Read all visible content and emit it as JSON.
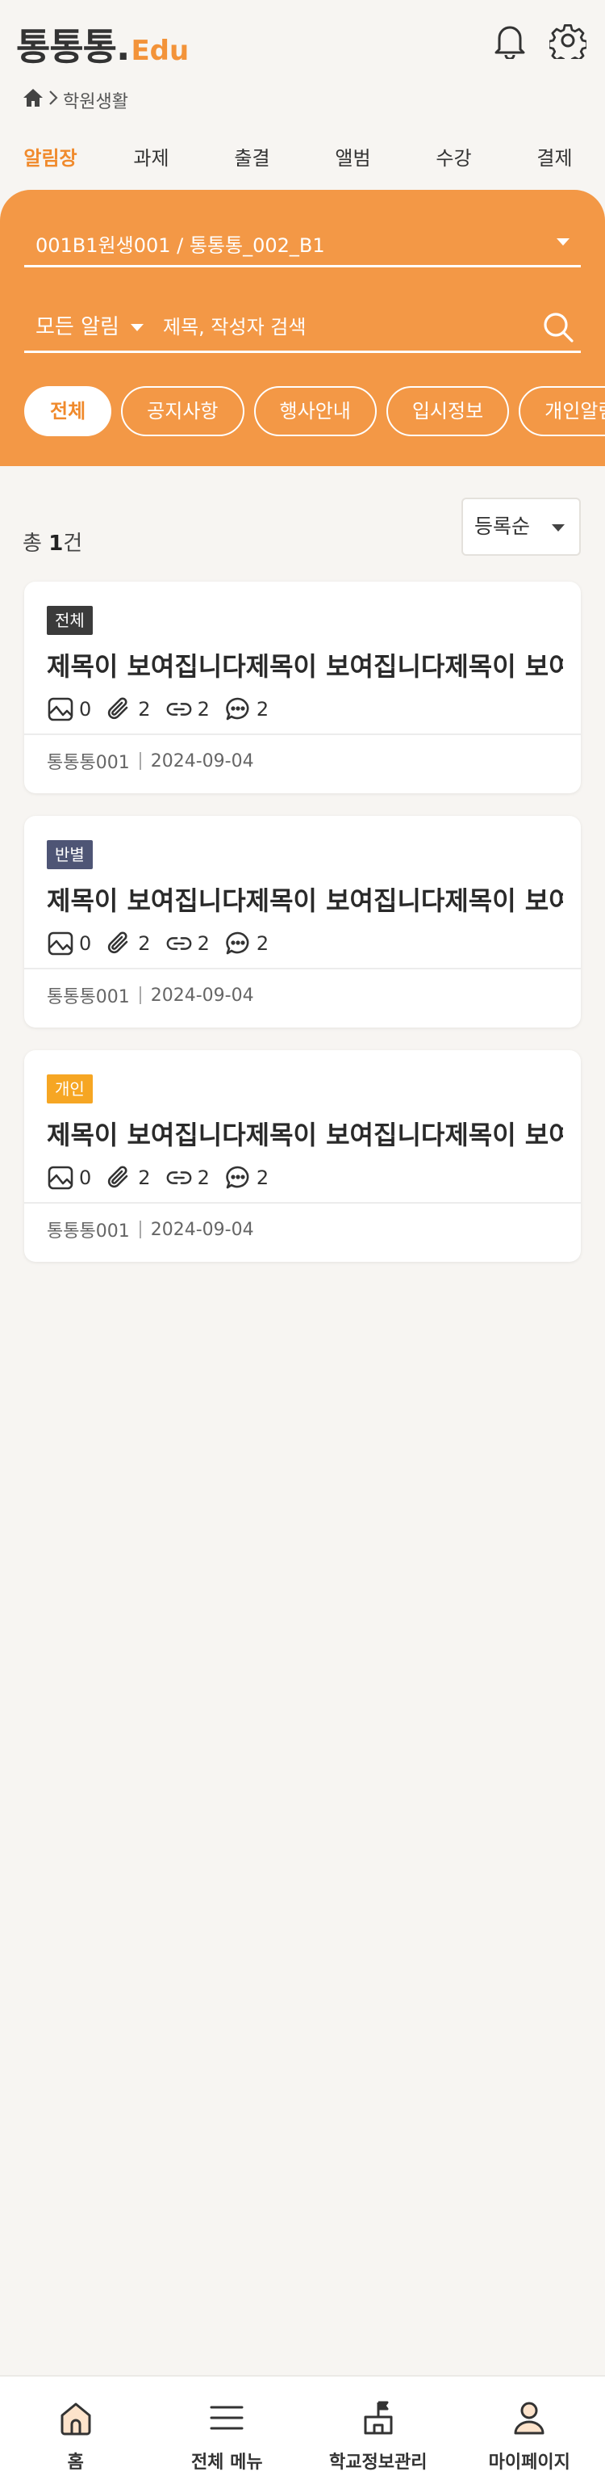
{
  "header": {
    "logo_main": "통통통.",
    "logo_edu": "Edu"
  },
  "breadcrumb": {
    "current": "학원생활"
  },
  "tabs": [
    {
      "label": "알림장",
      "active": true
    },
    {
      "label": "과제"
    },
    {
      "label": "출결"
    },
    {
      "label": "앨범"
    },
    {
      "label": "수강"
    },
    {
      "label": "결제"
    }
  ],
  "filter": {
    "class_select": "001B1원생001 / 통통통_002_B1",
    "notice_type": "모든 알림",
    "search_placeholder": "제목, 작성자 검색",
    "chips": [
      {
        "label": "전체",
        "active": true
      },
      {
        "label": "공지사항"
      },
      {
        "label": "행사안내"
      },
      {
        "label": "입시정보"
      },
      {
        "label": "개인알림"
      }
    ]
  },
  "list": {
    "count_prefix": "총 ",
    "count": "1",
    "count_suffix": "건",
    "sort": "등록순"
  },
  "cards": [
    {
      "badge": "전체",
      "badge_color": "#3b3b3b",
      "title": "제목이 보여집니다제목이 보여집니다제목이 보여..",
      "images": "0",
      "attachments": "2",
      "links": "2",
      "comments": "2",
      "author": "통통통001",
      "date": "2024-09-04"
    },
    {
      "badge": "반별",
      "badge_color": "#4e5575",
      "title": "제목이 보여집니다제목이 보여집니다제목이 보여..",
      "images": "0",
      "attachments": "2",
      "links": "2",
      "comments": "2",
      "author": "통통통001",
      "date": "2024-09-04"
    },
    {
      "badge": "개인",
      "badge_color": "#f6a623",
      "title": "제목이 보여집니다제목이 보여집니다제목이 보여..",
      "images": "0",
      "attachments": "2",
      "links": "2",
      "comments": "2",
      "author": "통통통001",
      "date": "2024-09-04"
    }
  ],
  "bottom_nav": [
    {
      "label": "홈",
      "icon": "home-icon"
    },
    {
      "label": "전체 메뉴",
      "icon": "menu-icon"
    },
    {
      "label": "학교정보관리",
      "icon": "school-icon"
    },
    {
      "label": "마이페이지",
      "icon": "user-icon"
    }
  ],
  "colors": {
    "accent": "#f39846",
    "accent_text": "#f08a2c"
  }
}
